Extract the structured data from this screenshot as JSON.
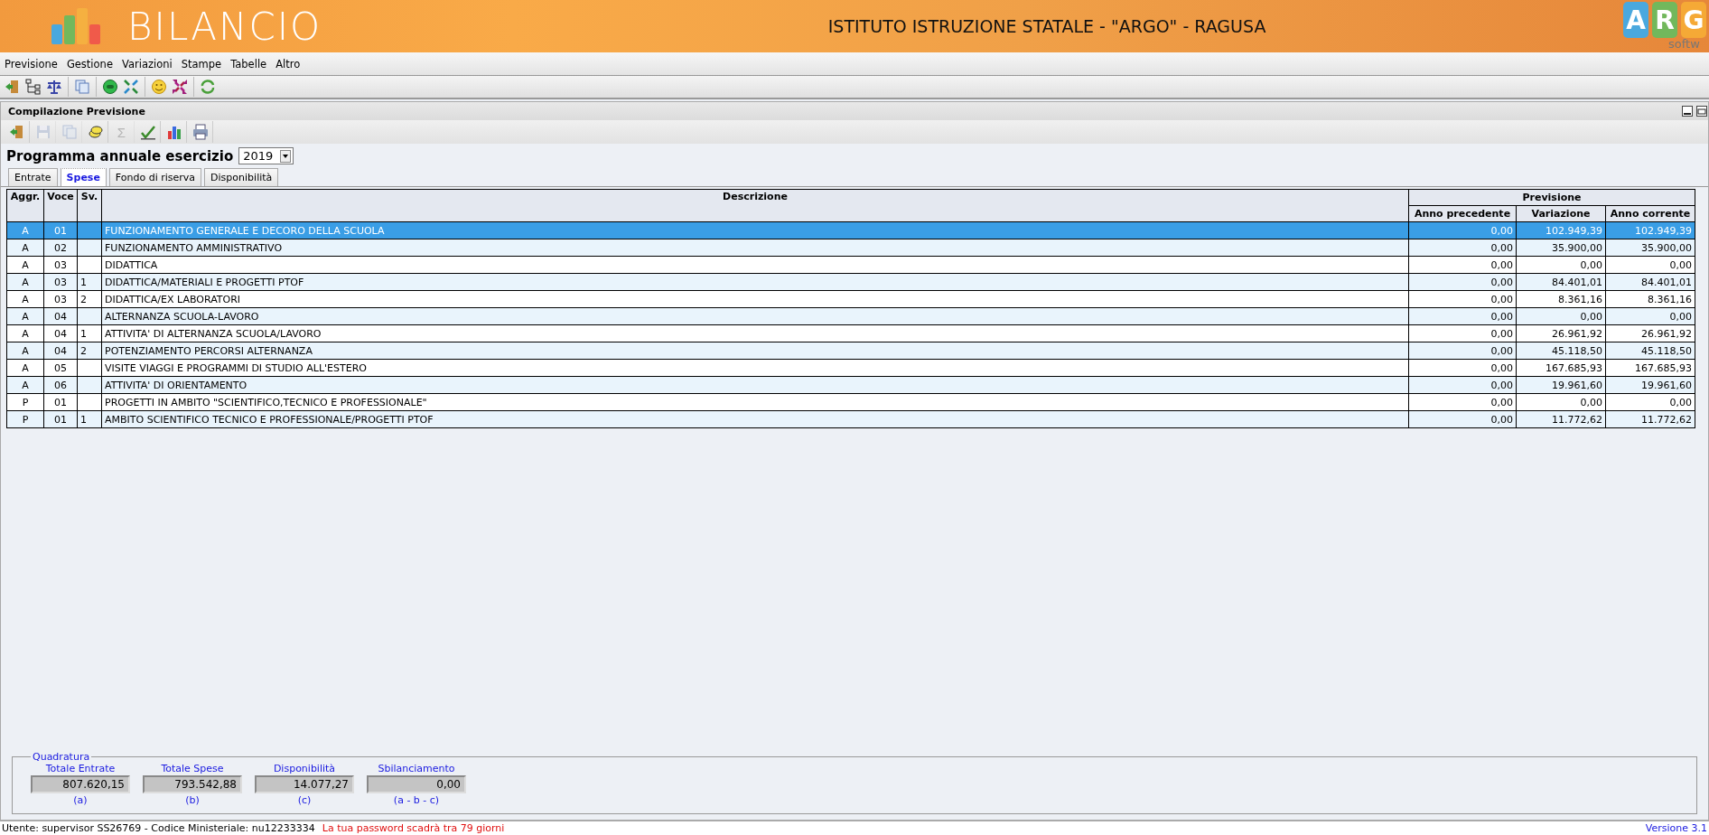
{
  "header": {
    "logo_text": "BILANCIO",
    "title": "ISTITUTO ISTRUZIONE STATALE - \"ARGO\" - RAGUSA",
    "brand_letters": [
      "A",
      "R",
      "G"
    ],
    "brand_sub": "softw"
  },
  "menu": [
    "Previsione",
    "Gestione",
    "Variazioni",
    "Stampe",
    "Tabelle",
    "Altro"
  ],
  "toolbar": [
    {
      "kind": "exit"
    },
    {
      "kind": "tree"
    },
    {
      "kind": "scales"
    },
    {
      "kind": "pages"
    },
    {
      "kind": "sad"
    },
    {
      "kind": "arrows_in"
    },
    {
      "kind": "smile"
    },
    {
      "kind": "arrows_out"
    },
    {
      "kind": "refresh"
    }
  ],
  "panel": {
    "title": "Compilazione Previsione",
    "toolbar": [
      {
        "kind": "exit",
        "disabled": false
      },
      {
        "kind": "save",
        "disabled": true
      },
      {
        "kind": "pages",
        "disabled": true
      },
      {
        "kind": "coins",
        "disabled": false
      },
      {
        "kind": "sigma",
        "disabled": true,
        "text": "Σ"
      },
      {
        "kind": "check",
        "disabled": false
      },
      {
        "kind": "chart",
        "disabled": false
      },
      {
        "kind": "printer",
        "disabled": false
      }
    ],
    "year_label": "Programma annuale esercizio",
    "year": "2019",
    "tabs": [
      {
        "label": "Entrate",
        "selected": false
      },
      {
        "label": "Spese",
        "selected": true
      },
      {
        "label": "Fondo di riserva",
        "selected": false
      },
      {
        "label": "Disponibilità",
        "selected": false
      }
    ]
  },
  "table": {
    "columns": [
      "Aggr.",
      "Voce",
      "Sv.",
      "Descrizione"
    ],
    "group": "Previsione",
    "group_columns": [
      "Anno precedente",
      "Variazione",
      "Anno corrente"
    ],
    "rows": [
      {
        "aggr": "A",
        "voce": "01",
        "sv": "",
        "descrizione": "FUNZIONAMENTO GENERALE E DECORO DELLA SCUOLA",
        "anno_precedente": "0,00",
        "variazione": "102.949,39",
        "anno_corrente": "102.949,39",
        "selected": true
      },
      {
        "aggr": "A",
        "voce": "02",
        "sv": "",
        "descrizione": "FUNZIONAMENTO AMMINISTRATIVO",
        "anno_precedente": "0,00",
        "variazione": "35.900,00",
        "anno_corrente": "35.900,00",
        "selected": false
      },
      {
        "aggr": "A",
        "voce": "03",
        "sv": "",
        "descrizione": "DIDATTICA",
        "anno_precedente": "0,00",
        "variazione": "0,00",
        "anno_corrente": "0,00",
        "selected": false
      },
      {
        "aggr": "A",
        "voce": "03",
        "sv": "1",
        "descrizione": "DIDATTICA/MATERIALI E PROGETTI PTOF",
        "anno_precedente": "0,00",
        "variazione": "84.401,01",
        "anno_corrente": "84.401,01",
        "selected": false
      },
      {
        "aggr": "A",
        "voce": "03",
        "sv": "2",
        "descrizione": "DIDATTICA/EX LABORATORI",
        "anno_precedente": "0,00",
        "variazione": "8.361,16",
        "anno_corrente": "8.361,16",
        "selected": false
      },
      {
        "aggr": "A",
        "voce": "04",
        "sv": "",
        "descrizione": "ALTERNANZA SCUOLA-LAVORO",
        "anno_precedente": "0,00",
        "variazione": "0,00",
        "anno_corrente": "0,00",
        "selected": false
      },
      {
        "aggr": "A",
        "voce": "04",
        "sv": "1",
        "descrizione": "ATTIVITA' DI ALTERNANZA SCUOLA/LAVORO",
        "anno_precedente": "0,00",
        "variazione": "26.961,92",
        "anno_corrente": "26.961,92",
        "selected": false
      },
      {
        "aggr": "A",
        "voce": "04",
        "sv": "2",
        "descrizione": "POTENZIAMENTO PERCORSI ALTERNANZA",
        "anno_precedente": "0,00",
        "variazione": "45.118,50",
        "anno_corrente": "45.118,50",
        "selected": false
      },
      {
        "aggr": "A",
        "voce": "05",
        "sv": "",
        "descrizione": "VISITE VIAGGI E PROGRAMMI DI STUDIO ALL'ESTERO",
        "anno_precedente": "0,00",
        "variazione": "167.685,93",
        "anno_corrente": "167.685,93",
        "selected": false
      },
      {
        "aggr": "A",
        "voce": "06",
        "sv": "",
        "descrizione": "ATTIVITA' DI ORIENTAMENTO",
        "anno_precedente": "0,00",
        "variazione": "19.961,60",
        "anno_corrente": "19.961,60",
        "selected": false
      },
      {
        "aggr": "P",
        "voce": "01",
        "sv": "",
        "descrizione": "PROGETTI IN AMBITO \"SCIENTIFICO,TECNICO E PROFESSIONALE\"",
        "anno_precedente": "0,00",
        "variazione": "0,00",
        "anno_corrente": "0,00",
        "selected": false
      },
      {
        "aggr": "P",
        "voce": "01",
        "sv": "1",
        "descrizione": "AMBITO SCIENTIFICO TECNICO E PROFESSIONALE/PROGETTI PTOF",
        "anno_precedente": "0,00",
        "variazione": "11.772,62",
        "anno_corrente": "11.772,62",
        "selected": false
      }
    ]
  },
  "quadratura": {
    "legend": "Quadratura",
    "fields": [
      {
        "label": "Totale Entrate",
        "value": "807.620,15",
        "note": "(a)"
      },
      {
        "label": "Totale Spese",
        "value": "793.542,88",
        "note": "(b)"
      },
      {
        "label": "Disponibilità",
        "value": "14.077,27",
        "note": "(c)"
      },
      {
        "label": "Sbilanciamento",
        "value": "0,00",
        "note": "(a - b - c)"
      }
    ]
  },
  "status_bar": {
    "user": "Utente: supervisor SS26769 - Codice Ministeriale: nu12233334",
    "warning": "La tua password scadrà tra 79 giorni",
    "version": "Versione 3.1"
  }
}
